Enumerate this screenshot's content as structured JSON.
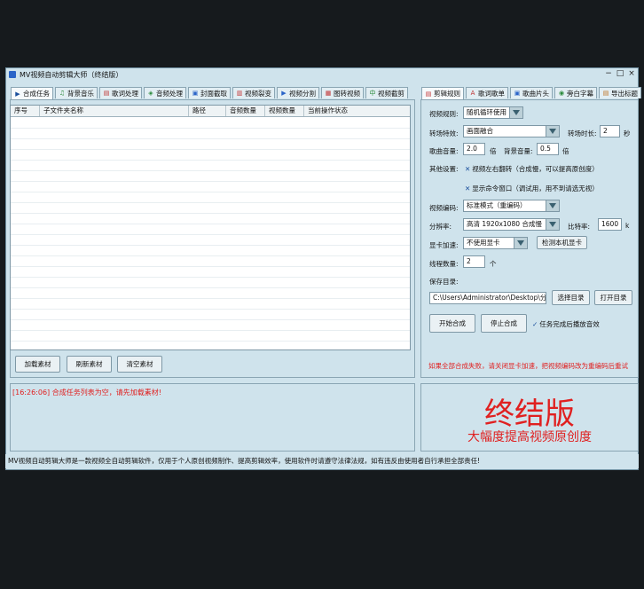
{
  "window": {
    "title": "MV视频自动剪辑大师（终结版）",
    "controls": [
      "−",
      "□",
      "×"
    ]
  },
  "left_tabs": [
    {
      "label": "合成任务",
      "icon": "play-icon"
    },
    {
      "label": "背景音乐",
      "icon": "music-icon"
    },
    {
      "label": "歌词处理",
      "icon": "lyrics-icon"
    },
    {
      "label": "音频处理",
      "icon": "audio-icon"
    },
    {
      "label": "封面截取",
      "icon": "cover-icon"
    },
    {
      "label": "视频裂变",
      "icon": "split-icon"
    },
    {
      "label": "视频分割",
      "icon": "cut-icon"
    },
    {
      "label": "图转视频",
      "icon": "image-icon"
    },
    {
      "label": "视频截剪",
      "icon": "crop-icon"
    }
  ],
  "table": {
    "columns": [
      "序号",
      "子文件夹名称",
      "路径",
      "音频数量",
      "视频数量",
      "当前操作状态"
    ]
  },
  "buttons": {
    "add": "加载素材",
    "refresh": "刷新素材",
    "clear": "清空素材",
    "start": "开始合成",
    "stop": "停止合成",
    "choose_dir": "选择目录",
    "open_dir": "打开目录",
    "detect_gpu": "检测本机显卡"
  },
  "right_tabs": [
    {
      "label": "剪辑规则",
      "icon": "rules-icon"
    },
    {
      "label": "歌词歌单",
      "icon": "text-icon"
    },
    {
      "label": "歌曲片头",
      "icon": "intro-icon"
    },
    {
      "label": "旁白字幕",
      "icon": "subtitle-icon"
    },
    {
      "label": "导出标题",
      "icon": "export-icon"
    }
  ],
  "settings": {
    "rule_label": "视频规则:",
    "rule_value": "随机循环使用",
    "transition_label": "转场特效:",
    "transition_value": "画面融合",
    "transition_len_label": "转场时长:",
    "transition_len_value": "2",
    "transition_len_unit": "秒",
    "song_vol_label": "歌曲音量:",
    "song_vol_value": "2.0",
    "song_vol_unit": "倍",
    "bg_vol_label": "背景音量:",
    "bg_vol_value": "0.5",
    "bg_vol_unit": "倍",
    "other_label": "其他设置:",
    "flip_check": "视频左右翻转（合成慢，可以提高原创度）",
    "console_check": "显示命令窗口（调试用，用不到请选无视）",
    "encode_label": "视频编码:",
    "encode_value": "标准模式（重编码）",
    "res_label": "分辨率:",
    "res_value": "高清 1920x1080 合成慢",
    "bitrate_label": "比特率:",
    "bitrate_value": "1600",
    "bitrate_unit": "k",
    "gpu_label": "显卡加速:",
    "gpu_value": "不使用显卡",
    "threads_label": "线程数量:",
    "threads_value": "2",
    "threads_unit": "个",
    "savedir_label": "保存目录:",
    "savedir_value": "C:\\Users\\Administrator\\Desktop\\分",
    "autoplay_check": "任务完成后播放音效",
    "warning": "如果全部合成失败，请关闭显卡加速，把视频编码改为重编码后重试"
  },
  "log": {
    "line": "[16:26:06] 合成任务列表为空，请先加载素材!"
  },
  "promo": {
    "title": "终结版",
    "subtitle": "大幅度提高视频原创度"
  },
  "status_bar": {
    "text": "MV视频自动剪辑大师是一款视频全自动剪辑软件，仅用于个人原创视频制作、提高剪辑效率，使用软件时请遵守法律法规，如有违反由使用者自行承担全部责任!"
  },
  "colors": {
    "window_bg": "#cfe3ec",
    "accent_red": "#e02020",
    "outer_bg": "#161a1d"
  }
}
